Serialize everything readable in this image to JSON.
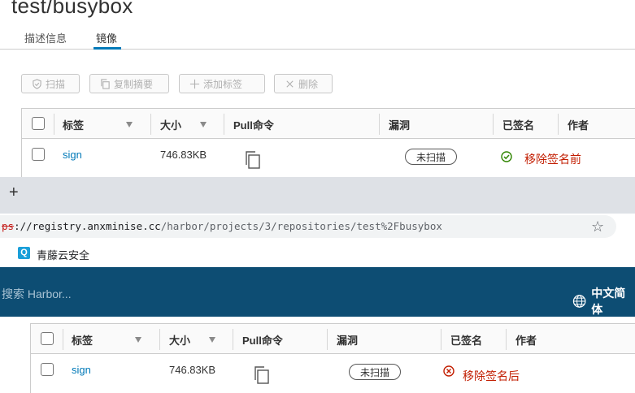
{
  "page": {
    "title": "test/busybox",
    "tabs": [
      "描述信息",
      "镜像"
    ]
  },
  "toolbar": {
    "scan": "扫描",
    "copy_digest": "复制摘要",
    "add_tag": "添加标签",
    "delete": "删除"
  },
  "columns": {
    "tag": "标签",
    "size": "大小",
    "pull": "Pull命令",
    "vuln": "漏洞",
    "signed": "已签名",
    "author": "作者"
  },
  "row_before": {
    "tag": "sign",
    "size": "746.83KB",
    "vuln": "未扫描",
    "note": "移除签名前"
  },
  "row_after": {
    "tag": "sign",
    "size": "746.83KB",
    "vuln": "未扫描",
    "note": "移除签名后"
  },
  "browser": {
    "new_tab": "+",
    "url_scheme": "ps",
    "url_host": "://registry.anxminise.cc",
    "url_path": "/harbor/projects/3/repositories/test%2Fbusybox",
    "bookmark_icon": "Q",
    "bookmark": "青藤云安全"
  },
  "harbor": {
    "search_placeholder": "搜索 Harbor...",
    "language": "中文简体"
  },
  "colors": {
    "accent": "#0079b8",
    "header": "#0d4d73",
    "signed_ok": "#2f8400",
    "unsigned": "#c21d00"
  }
}
